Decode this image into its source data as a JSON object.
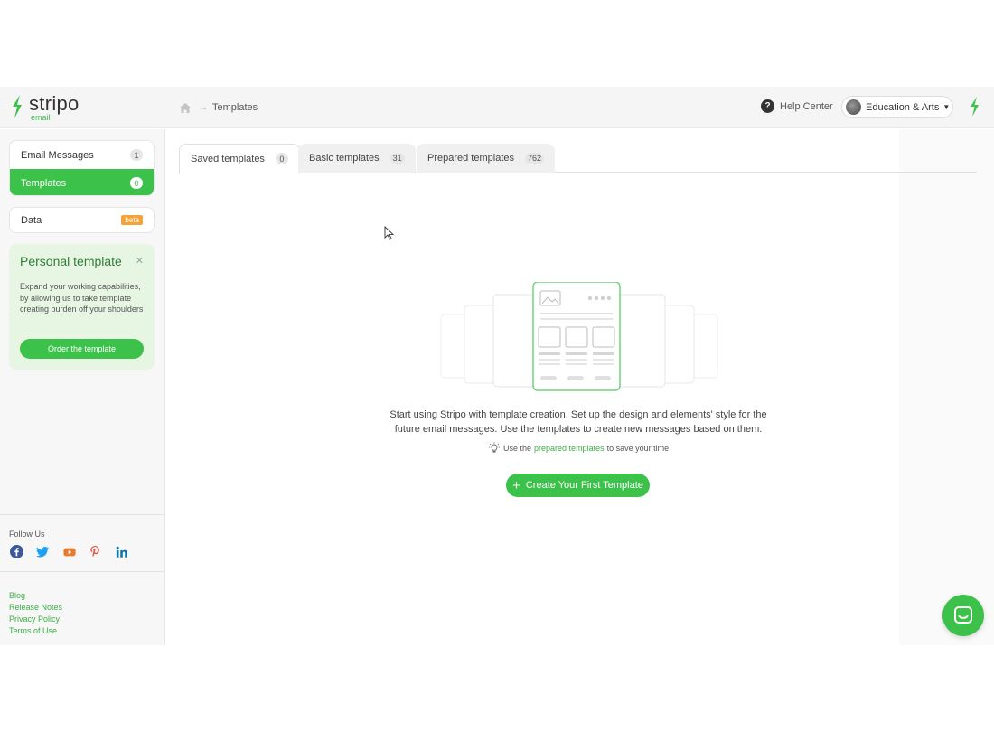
{
  "brand": {
    "name": "stripo",
    "sub": "email",
    "accent": "#3cc24a"
  },
  "breadcrumb": {
    "current": "Templates"
  },
  "header": {
    "help_label": "Help Center",
    "account_label": "Education & Arts"
  },
  "sidebar": {
    "items": [
      {
        "label": "Email Messages",
        "count": "1"
      },
      {
        "label": "Templates",
        "count": "0"
      }
    ],
    "data_item": {
      "label": "Data",
      "badge": "beta"
    },
    "promo": {
      "title": "Personal template",
      "text": "Expand your working capabilities, by allowing us to take template creating burden off your shoulders",
      "button": "Order the template"
    },
    "follow_label": "Follow Us",
    "socials": [
      "facebook-icon",
      "twitter-icon",
      "youtube-icon",
      "pinterest-icon",
      "linkedin-icon"
    ],
    "links": [
      "Blog",
      "Release Notes",
      "Privacy Policy",
      "Terms of Use"
    ]
  },
  "tabs": [
    {
      "label": "Saved templates",
      "count": "0"
    },
    {
      "label": "Basic templates",
      "count": "31"
    },
    {
      "label": "Prepared templates",
      "count": "762"
    }
  ],
  "empty_state": {
    "message": "Start using Stripo with template creation. Set up the design and elements' style for the future email messages. Use the templates to create new messages based on them.",
    "tip_prefix": "Use the",
    "tip_link": "prepared templates",
    "tip_suffix": "to save your time",
    "button": "Create Your First Template"
  }
}
